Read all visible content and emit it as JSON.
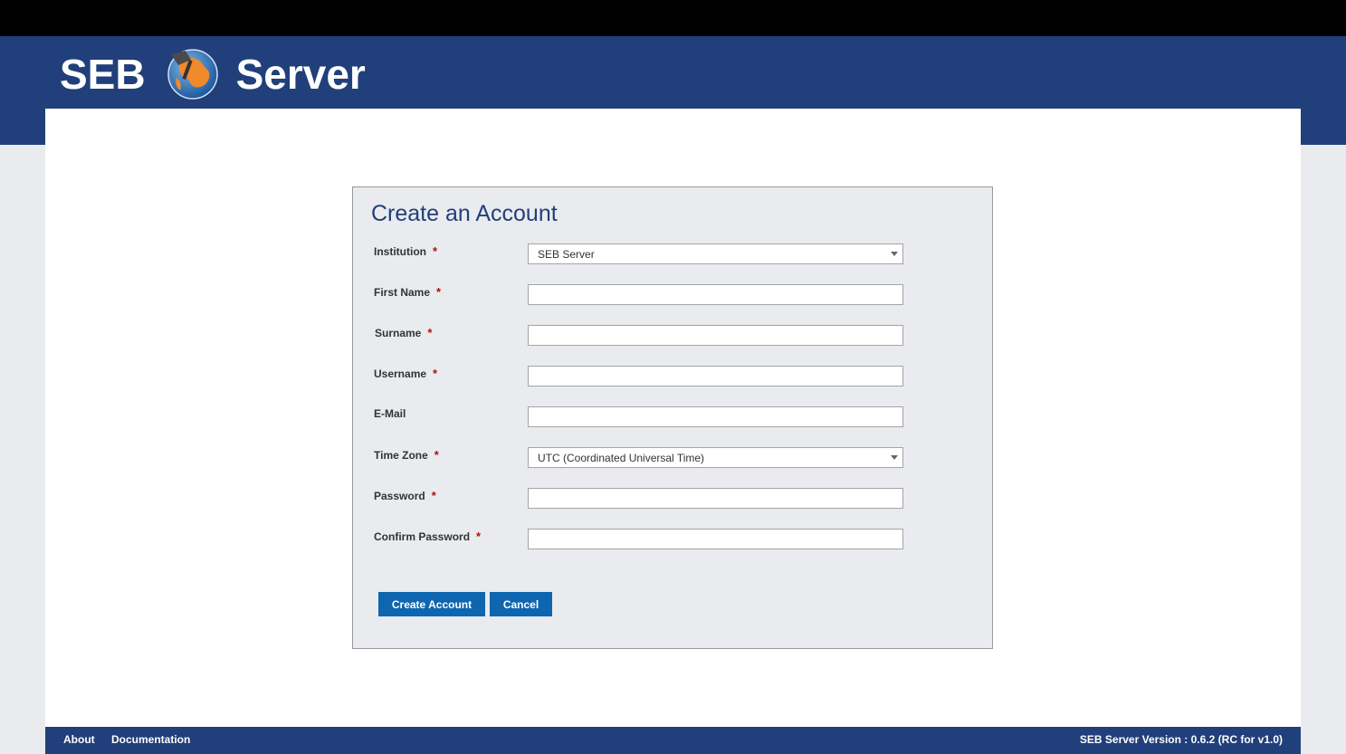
{
  "header": {
    "logo_left": "SEB",
    "logo_right": "Server"
  },
  "form": {
    "title": "Create an Account",
    "fields": [
      {
        "label": "Institution",
        "required": true,
        "type": "select",
        "value": "SEB Server"
      },
      {
        "label": "First Name",
        "required": true,
        "type": "text",
        "value": ""
      },
      {
        "label": "Surname",
        "required": true,
        "type": "text",
        "value": ""
      },
      {
        "label": "Username",
        "required": true,
        "type": "text",
        "value": ""
      },
      {
        "label": "E-Mail",
        "required": false,
        "type": "text",
        "value": ""
      },
      {
        "label": "Time Zone",
        "required": true,
        "type": "select",
        "value": "UTC (Coordinated Universal Time)"
      },
      {
        "label": "Password",
        "required": true,
        "type": "password",
        "value": ""
      },
      {
        "label": "Confirm Password",
        "required": true,
        "type": "password",
        "value": ""
      }
    ],
    "required_marker": "*",
    "create_label": "Create Account",
    "cancel_label": "Cancel"
  },
  "footer": {
    "about": "About",
    "documentation": "Documentation",
    "version": "SEB Server Version : 0.6.2 (RC for v1.0)"
  },
  "colors": {
    "brand_navy": "#213f7a",
    "button_blue": "#0e66b0",
    "required_red": "#b01010"
  }
}
